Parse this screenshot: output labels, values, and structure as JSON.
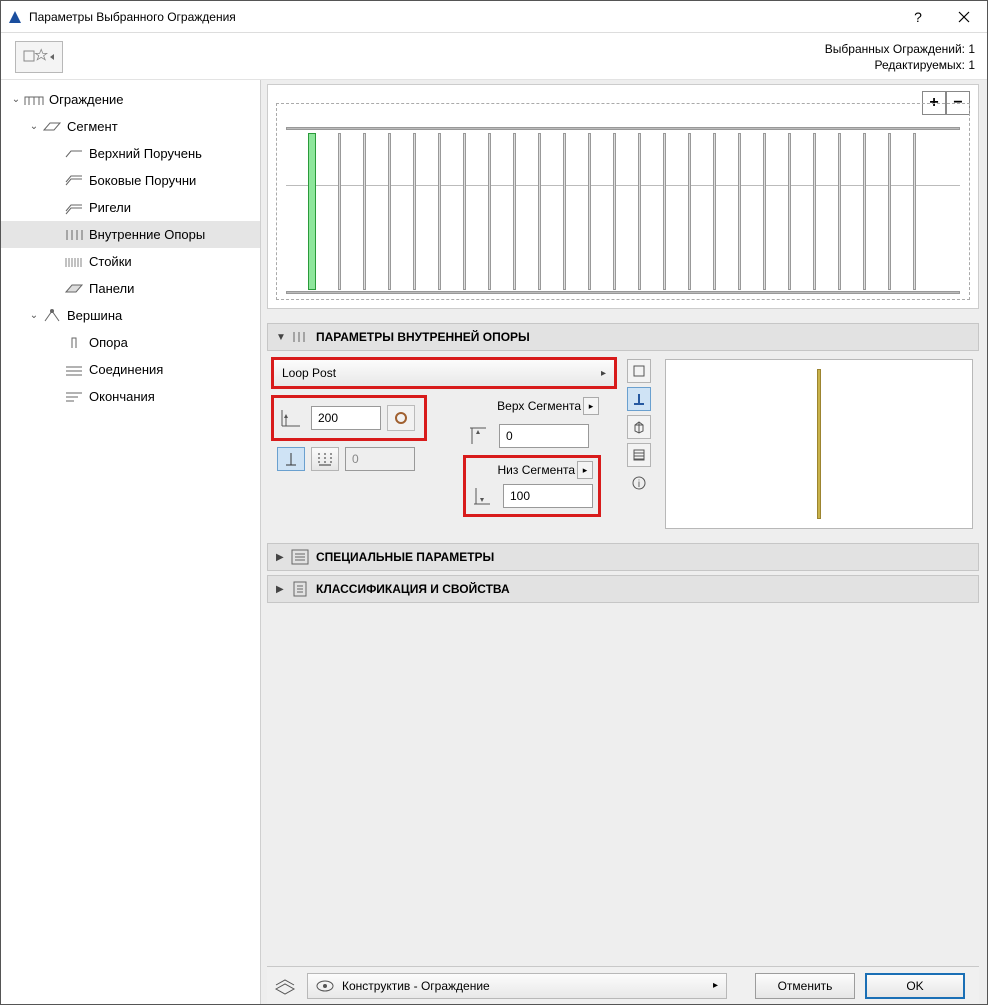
{
  "window": {
    "title": "Параметры Выбранного Ограждения"
  },
  "info": {
    "selected": "Выбранных Ограждений: 1",
    "editable": "Редактируемых: 1"
  },
  "tree": {
    "root": "Ограждение",
    "segment": "Сегмент",
    "top_rail": "Верхний Поручень",
    "side_rails": "Боковые Поручни",
    "rails": "Ригели",
    "inner_posts": "Внутренние Опоры",
    "balusters": "Стойки",
    "panels": "Панели",
    "node": "Вершина",
    "post": "Опора",
    "connections": "Соединения",
    "ends": "Окончания"
  },
  "zoom": {
    "in": "+",
    "out": "−"
  },
  "sections": {
    "params": "ПАРАМЕТРЫ ВНУТРЕННЕЙ ОПОРЫ",
    "special": "СПЕЦИАЛЬНЫЕ ПАРАМЕТРЫ",
    "class": "КЛАССИФИКАЦИЯ И СВОЙСТВА"
  },
  "post_select": "Loop Post",
  "offsets": {
    "horiz": "200",
    "spacing": "0",
    "top_label": "Верх Сегмента",
    "top_value": "0",
    "bottom_label": "Низ Сегмента",
    "bottom_value": "100"
  },
  "layer": {
    "label": "Конструктив - Ограждение"
  },
  "buttons": {
    "cancel": "Отменить",
    "ok": "OK"
  }
}
